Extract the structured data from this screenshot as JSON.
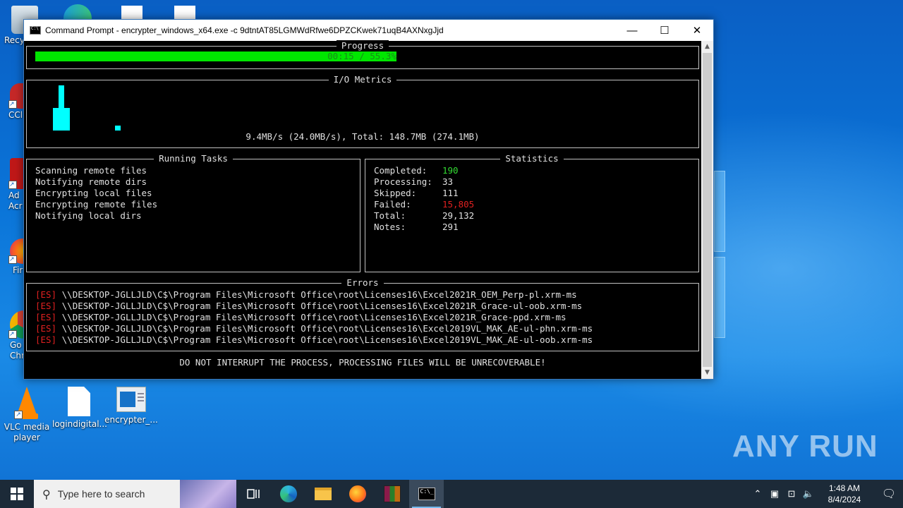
{
  "window": {
    "title": "Command Prompt - encrypter_windows_x64.exe  -c 9dtntAT85LGMWdRfwe6DPZCKwek71uqB4AXNxgJjd",
    "min_glyph": "—",
    "max_glyph": "☐",
    "close_glyph": "✕"
  },
  "progress": {
    "title": "Progress",
    "label": "00:15 / 55.3%",
    "fraction": 0.553
  },
  "io": {
    "title": "I/O Metrics",
    "summary": "9.4MB/s (24.0MB/s), Total: 148.7MB (274.1MB)"
  },
  "tasks": {
    "title": "Running Tasks",
    "items": [
      "Scanning remote files",
      "Notifying remote dirs",
      "Encrypting local files",
      "Encrypting remote files",
      "Notifying local dirs"
    ]
  },
  "stats": {
    "title": "Statistics",
    "rows": [
      {
        "key": "Completed:",
        "value": "190"
      },
      {
        "key": "Processing:",
        "value": "33"
      },
      {
        "key": "Skipped:",
        "value": "111"
      },
      {
        "key": "Failed:",
        "value": "15,805"
      },
      {
        "key": "Total:",
        "value": "29,132"
      },
      {
        "key": "Notes:",
        "value": "291"
      }
    ]
  },
  "errors": {
    "title": "Errors",
    "items": [
      {
        "tag": "[ES]",
        "path": "\\\\DESKTOP-JGLLJLD\\C$\\Program Files\\Microsoft Office\\root\\Licenses16\\Excel2021R_OEM_Perp-pl.xrm-ms"
      },
      {
        "tag": "[ES]",
        "path": "\\\\DESKTOP-JGLLJLD\\C$\\Program Files\\Microsoft Office\\root\\Licenses16\\Excel2021R_Grace-ul-oob.xrm-ms"
      },
      {
        "tag": "[ES]",
        "path": "\\\\DESKTOP-JGLLJLD\\C$\\Program Files\\Microsoft Office\\root\\Licenses16\\Excel2021R_Grace-ppd.xrm-ms"
      },
      {
        "tag": "[ES]",
        "path": "\\\\DESKTOP-JGLLJLD\\C$\\Program Files\\Microsoft Office\\root\\Licenses16\\Excel2019VL_MAK_AE-ul-phn.xrm-ms"
      },
      {
        "tag": "[ES]",
        "path": "\\\\DESKTOP-JGLLJLD\\C$\\Program Files\\Microsoft Office\\root\\Licenses16\\Excel2019VL_MAK_AE-ul-oob.xrm-ms"
      }
    ]
  },
  "footer_warning": "DO NOT INTERRUPT THE PROCESS, PROCESSING FILES WILL BE UNRECOVERABLE!",
  "desktop": {
    "icons": [
      {
        "label": "Recy",
        "icon": "recycle-bin-icon"
      },
      {
        "label": "CCl",
        "icon": "ccleaner-icon"
      },
      {
        "label": "Ad Acr",
        "icon": "acrobat-icon"
      },
      {
        "label": "Fir",
        "icon": "firefox-icon"
      },
      {
        "label": "Go Chr",
        "icon": "chrome-icon"
      },
      {
        "label": "VLC media player",
        "icon": "vlc-icon"
      },
      {
        "label": "logindigital...",
        "icon": "file-icon"
      },
      {
        "label": "encrypter_...",
        "icon": "exe-icon"
      }
    ]
  },
  "taskbar": {
    "search_placeholder": "Type here to search",
    "time": "1:48 AM",
    "date": "8/4/2024",
    "accent": "#1c2a38"
  },
  "watermark": "ANY RUN"
}
